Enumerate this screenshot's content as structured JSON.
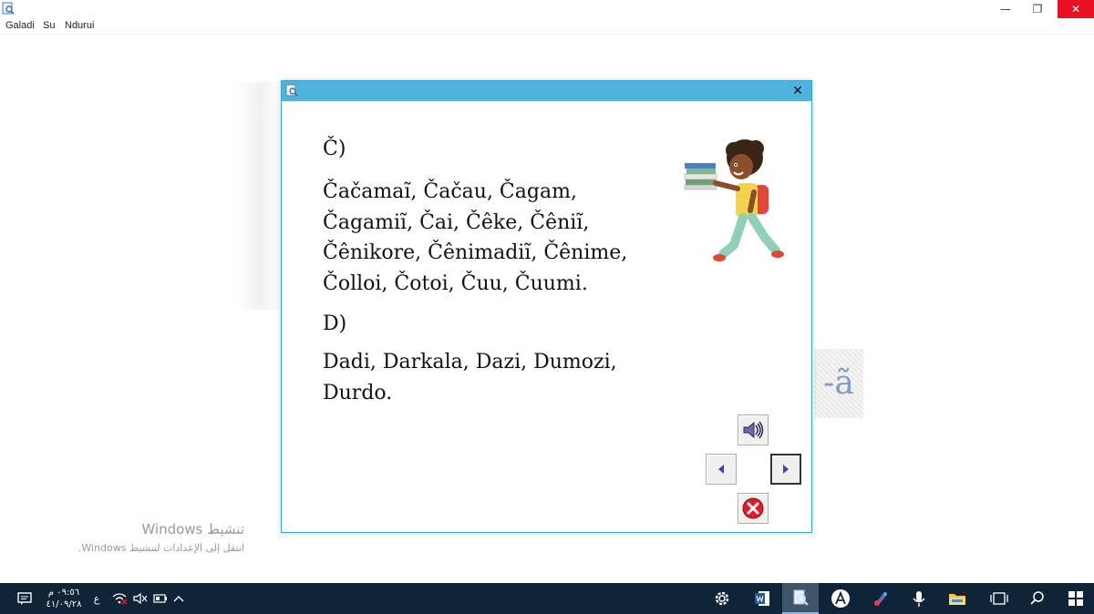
{
  "menu": {
    "items": [
      "Galadi",
      "Su",
      "Ndurui"
    ]
  },
  "window": {
    "minimize": "—",
    "restore": "❐",
    "close": "✕"
  },
  "dialog": {
    "close": "✕",
    "sections": [
      {
        "heading": "Č)",
        "lines": [
          "Čačamaĩ, Čačau, Čagam,",
          "Čagamiĩ, Čai, Čêke, Čêniĩ,",
          "Čênikore, Čênimadiĩ, Čênime,",
          "Čolloi, Čotoi, Čuu, Čuumi."
        ]
      },
      {
        "heading": "D)",
        "lines": [
          "Dadi, Darkala, Dazi, Dumozi,",
          "Durdo."
        ]
      }
    ],
    "controls": {
      "sound_icon": "speaker-icon",
      "prev_icon": "triangle-left-icon",
      "next_icon": "triangle-right-icon",
      "exit_icon": "close-circle-icon"
    }
  },
  "background": {
    "fragment": "-ã"
  },
  "watermark": {
    "title": "تنشيط Windows",
    "subtitle": "انتقل إلى الإعدادات لتنشيط Windows."
  },
  "taskbar": {
    "clock_time": "٠٩:٥٦ م",
    "clock_date": "٤١/٠٩/٢٨",
    "language": "ع",
    "chevron": "^"
  },
  "colors": {
    "dialog_titlebar": "#4fb3dc",
    "taskbar": "#0f2436",
    "close_red": "#e81123"
  }
}
